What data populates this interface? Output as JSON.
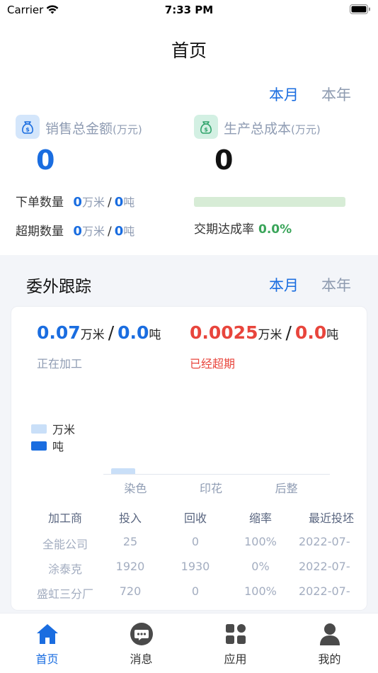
{
  "status_bar": {
    "carrier": "Carrier",
    "time": "7:33 PM"
  },
  "nav": {
    "title": "首页"
  },
  "overview": {
    "tabs": [
      {
        "label": "本月",
        "active": true
      },
      {
        "label": "本年",
        "active": false
      }
    ],
    "sales": {
      "label": "销售总金额",
      "unit": "(万元)",
      "value": "0"
    },
    "cost": {
      "label": "生产总成本",
      "unit": "(万元)",
      "value": "0"
    },
    "orders": {
      "label": "下单数量",
      "meters": "0",
      "meters_unit": "万米",
      "sep": "/",
      "tons": "0",
      "tons_unit": "吨"
    },
    "overdue": {
      "label": "超期数量",
      "meters": "0",
      "meters_unit": "万米",
      "sep": "/",
      "tons": "0",
      "tons_unit": "吨"
    },
    "delivery": {
      "label": "交期达成率",
      "value": "0.0%",
      "progress": 0
    }
  },
  "outsource": {
    "title": "委外跟踪",
    "tabs": [
      {
        "label": "本月",
        "active": true
      },
      {
        "label": "本年",
        "active": false
      }
    ],
    "processing": {
      "meters": "0.07",
      "meters_unit": "万米",
      "sep": "/",
      "tons": "0.0",
      "tons_unit": "吨",
      "caption": "正在加工"
    },
    "overdue": {
      "meters": "0.0025",
      "meters_unit": "万米",
      "sep": "/",
      "tons": "0.0",
      "tons_unit": "吨",
      "caption": "已经超期"
    },
    "chart_data": {
      "type": "bar",
      "categories": [
        "染色",
        "印花",
        "后整"
      ],
      "series": [
        {
          "name": "万米",
          "values": [
            0.07,
            0,
            0
          ]
        },
        {
          "name": "吨",
          "values": [
            0,
            0,
            0
          ]
        }
      ],
      "ylim": [
        0,
        2.5
      ],
      "legend": "top-left",
      "grid": false
    },
    "table": {
      "headers": [
        "加工商",
        "投入",
        "回收",
        "缩率",
        "最近投坯"
      ],
      "rows": [
        [
          "全能公司",
          "25",
          "0",
          "100%",
          "2022-07-"
        ],
        [
          "涂泰克",
          "1920",
          "1930",
          "0%",
          "2022-07-"
        ],
        [
          "盛虹三分厂",
          "720",
          "0",
          "100%",
          "2022-07-"
        ]
      ]
    }
  },
  "tab_bar": {
    "items": [
      {
        "label": "首页",
        "icon": "home-icon",
        "active": true
      },
      {
        "label": "消息",
        "icon": "message-icon",
        "active": false
      },
      {
        "label": "应用",
        "icon": "apps-icon",
        "active": false
      },
      {
        "label": "我的",
        "icon": "profile-icon",
        "active": false
      }
    ]
  },
  "colors": {
    "accent": "#1a6de0",
    "danger": "#e8453c",
    "success": "#3aa55a",
    "muted": "#8f9cb3",
    "bar_light": "#c9dff8",
    "bar_dark": "#1a6de0"
  }
}
